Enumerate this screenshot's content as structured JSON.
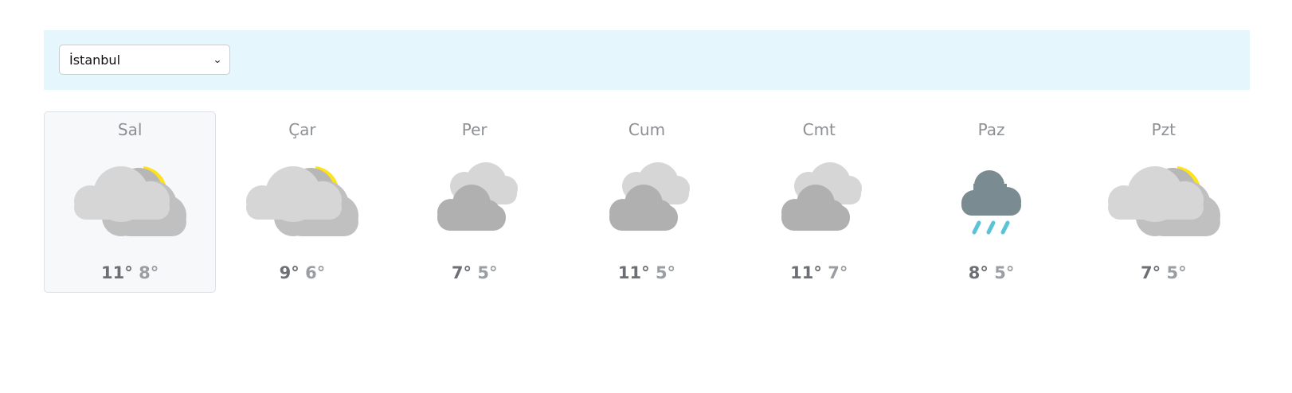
{
  "location": {
    "selected": "İstanbul"
  },
  "forecast": [
    {
      "day": "Sal",
      "icon": "partly-cloudy-icon",
      "high": "11°",
      "low": "8°",
      "selected": true
    },
    {
      "day": "Çar",
      "icon": "partly-cloudy-icon",
      "high": "9°",
      "low": "6°",
      "selected": false
    },
    {
      "day": "Per",
      "icon": "cloudy-icon",
      "high": "7°",
      "low": "5°",
      "selected": false
    },
    {
      "day": "Cum",
      "icon": "cloudy-icon",
      "high": "11°",
      "low": "5°",
      "selected": false
    },
    {
      "day": "Cmt",
      "icon": "cloudy-icon",
      "high": "11°",
      "low": "7°",
      "selected": false
    },
    {
      "day": "Paz",
      "icon": "rain-icon",
      "high": "8°",
      "low": "5°",
      "selected": false
    },
    {
      "day": "Pzt",
      "icon": "partly-cloudy-icon",
      "high": "7°",
      "low": "5°",
      "selected": false
    }
  ],
  "colors": {
    "topbar_bg": "#e5f7fc",
    "sun": "#fde31d",
    "cloud_light": "#d6d6d6",
    "cloud_mid": "#c0c0c0",
    "cloud_dark": "#b0b0b0",
    "rain_cloud": "#7a8b91",
    "rain_drop": "#5bc3d8"
  }
}
